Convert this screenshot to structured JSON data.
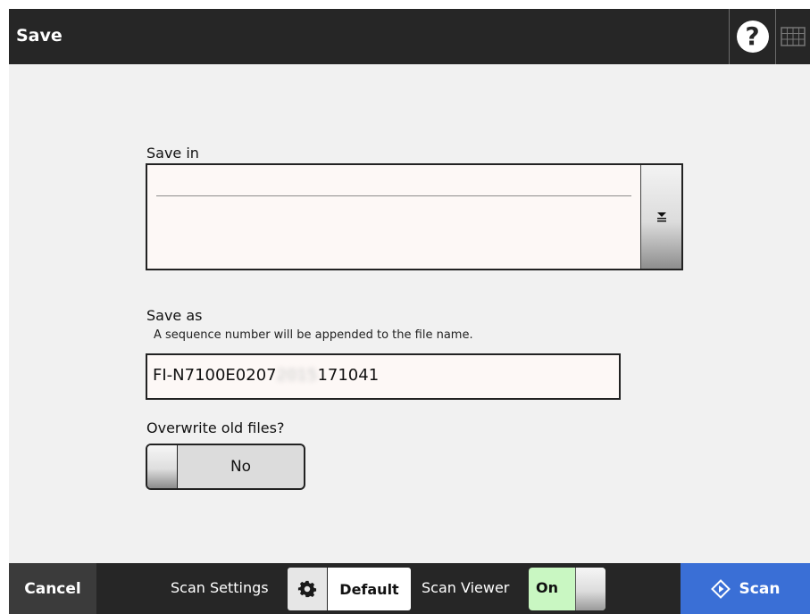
{
  "header": {
    "title": "Save",
    "help_label": "?",
    "help_icon": "question-mark-icon",
    "keyboard_icon": "keyboard-icon"
  },
  "save_in": {
    "label": "Save in",
    "value": "",
    "dropdown_icon": "collapse-down-icon"
  },
  "save_as": {
    "label": "Save as",
    "hint": "A sequence number will be appended to the file name.",
    "value_prefix": "FI-N7100E0207",
    "value_blurred": "2015",
    "value_suffix": "171041"
  },
  "overwrite": {
    "label": "Overwrite old files?",
    "state": "No"
  },
  "footer": {
    "cancel_label": "Cancel",
    "scan_settings_label": "Scan Settings",
    "settings_icon": "gear-icon",
    "default_label": "Default",
    "scan_viewer_label": "Scan Viewer",
    "scan_viewer_state": "On",
    "scan_label": "Scan",
    "scan_icon": "diamond-start-icon"
  },
  "colors": {
    "header_bg": "#262626",
    "main_bg": "#f1f1f1",
    "scan_button": "#3a6fd6",
    "viewer_on": "#c9f7c2",
    "field_bg": "#fdf8f6"
  }
}
